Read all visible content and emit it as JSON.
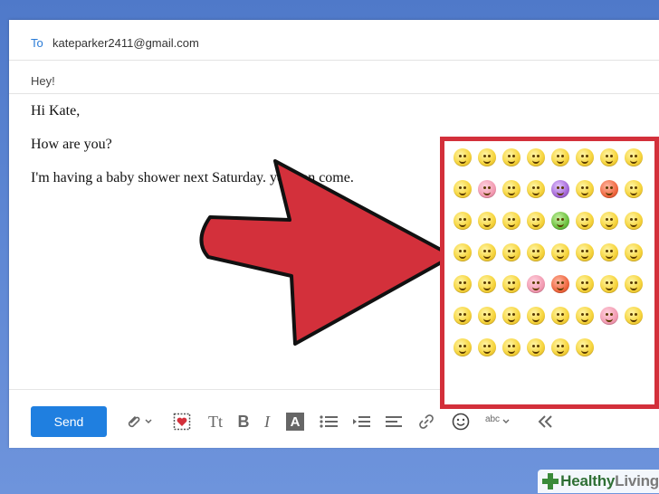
{
  "compose": {
    "to_label": "To",
    "to_value": "kateparker2411@gmail.com",
    "subject": "Hey!",
    "body_lines": [
      "Hi Kate,",
      "How are you?",
      "I'm having a baby shower next Saturday. you can come."
    ]
  },
  "toolbar": {
    "send_label": "Send",
    "text_size_label": "Tt",
    "bold_label": "B",
    "italic_label": "I",
    "text_color_label": "A",
    "spellcheck_label": "abc",
    "icons": [
      "paperclip-icon",
      "stationery-icon",
      "text-size-icon",
      "bold-icon",
      "italic-icon",
      "text-color-icon",
      "bullet-list-icon",
      "indent-icon",
      "align-icon",
      "link-icon",
      "emoji-icon",
      "spellcheck-icon",
      "collapse-icon"
    ]
  },
  "emoji_panel": {
    "count": 54,
    "accent_color": "#d3303b"
  },
  "watermark": {
    "brand": "Healthy",
    "brand_suffix": "Living"
  },
  "colors": {
    "send_button": "#1f7fe0",
    "arrow": "#d3303b",
    "background": "#5d86d3"
  }
}
